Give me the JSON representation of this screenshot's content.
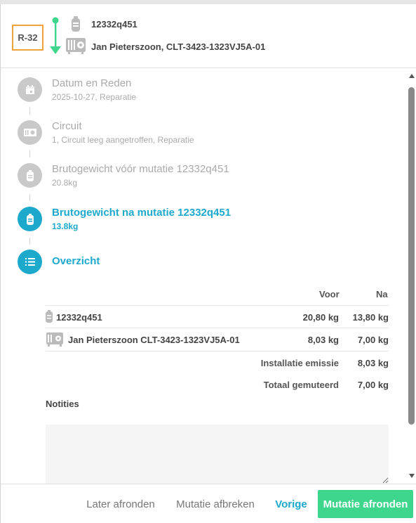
{
  "header": {
    "badge": "R-32",
    "cylinder_id": "12332q451",
    "installation": "Jan Pieterszoon, CLT-3423-1323VJ5A-01"
  },
  "steps": [
    {
      "title": "Datum en Reden",
      "subtitle": "2025-10-27, Reparatie",
      "icon": "calendar-icon",
      "state": "done"
    },
    {
      "title": "Circuit",
      "subtitle": "1, Circuit leeg aangetroffen, Reparatie",
      "icon": "circuit-icon",
      "state": "done"
    },
    {
      "title": "Brutogewicht vóór mutatie 12332q451",
      "subtitle": "20.8kg",
      "icon": "cylinder-icon",
      "state": "done"
    },
    {
      "title": "Brutogewicht na mutatie 12332q451",
      "subtitle": "13.8kg",
      "icon": "cylinder-icon",
      "state": "active"
    },
    {
      "title": "Overzicht",
      "subtitle": "",
      "icon": "list-icon",
      "state": "active"
    }
  ],
  "overview": {
    "col_before": "Voor",
    "col_after": "Na",
    "rows": [
      {
        "label": "12332q451",
        "before": "20,80 kg",
        "after": "13,80 kg"
      },
      {
        "label": "Jan Pieterszoon CLT-3423-1323VJ5A-01",
        "before": "8,03 kg",
        "after": "7,00 kg"
      }
    ],
    "installation_emission_label": "Installatie emissie",
    "installation_emission_value": "8,03 kg",
    "total_label": "Totaal gemuteerd",
    "total_value": "7,00 kg"
  },
  "notes": {
    "label": "Notities",
    "value": ""
  },
  "footer": {
    "later": "Later afronden",
    "abort": "Mutatie afbreken",
    "previous": "Vorige",
    "finish": "Mutatie afronden"
  },
  "colors": {
    "accent": "#1da9cc",
    "success": "#3dd68c",
    "badge_border": "#f0a33a",
    "inactive": "#c9c9c9"
  }
}
